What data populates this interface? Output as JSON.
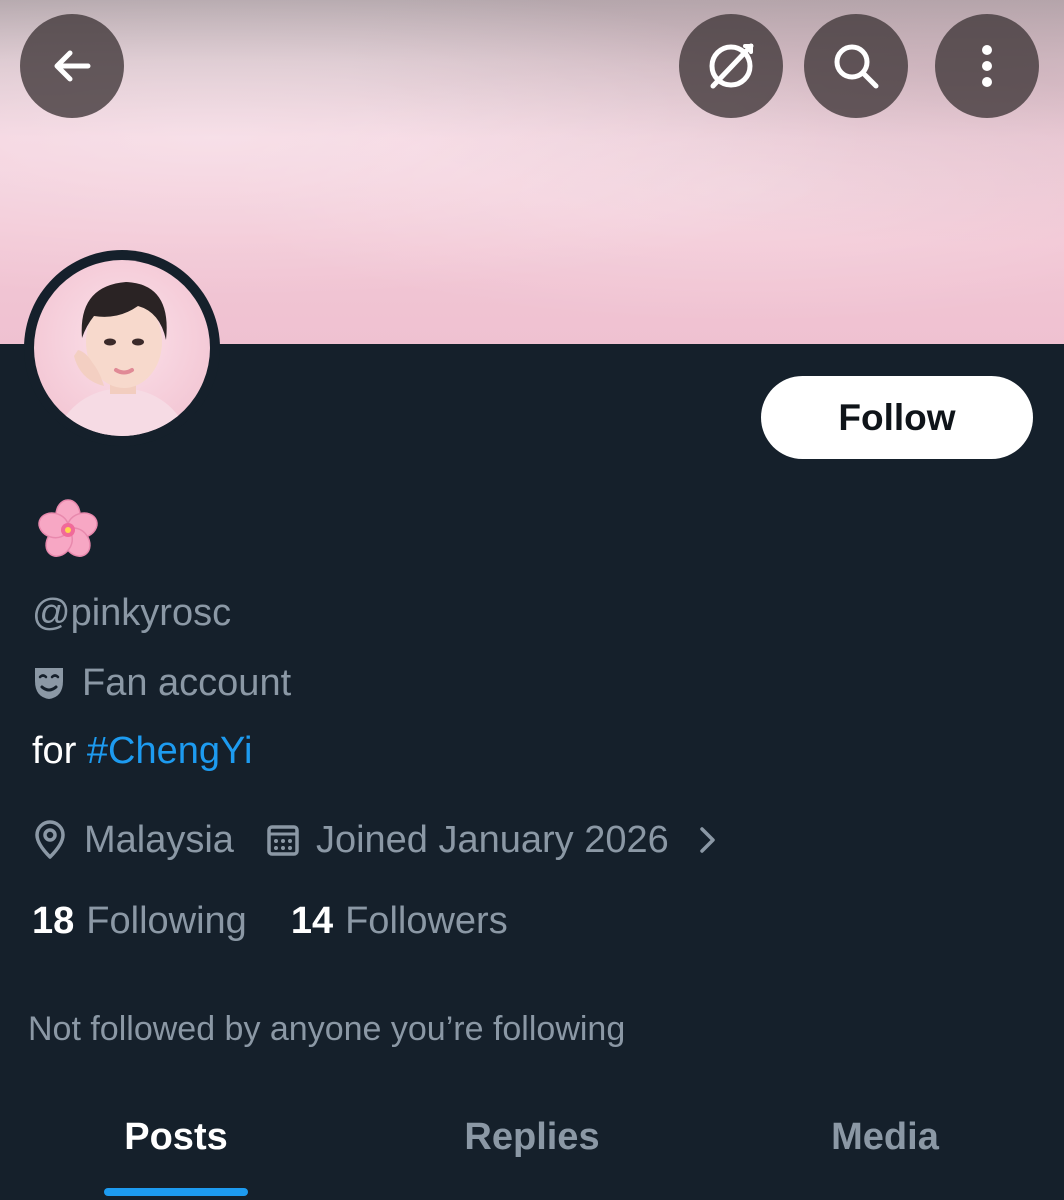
{
  "header": {
    "back_icon": "arrow-left-icon",
    "grok_icon": "grok-icon",
    "search_icon": "search-icon",
    "more_icon": "more-vertical-icon"
  },
  "profile": {
    "name_emoji": "cherry-blossom-icon",
    "handle": "@pinkyrosc",
    "category_icon": "theater-masks-icon",
    "category": "Fan account",
    "bio_prefix": "for ",
    "bio_hashtag": "#ChengYi",
    "location": "Malaysia",
    "joined": "Joined January 2026",
    "following_count": "18",
    "following_label": "Following",
    "followers_count": "14",
    "followers_label": "Followers",
    "not_followed_text": "Not followed by anyone you’re following"
  },
  "actions": {
    "follow_label": "Follow"
  },
  "tabs": [
    {
      "label": "Posts",
      "active": true
    },
    {
      "label": "Replies",
      "active": false
    },
    {
      "label": "Media",
      "active": false
    }
  ],
  "colors": {
    "background": "#15202b",
    "accent": "#1d9bf0",
    "muted_text": "#8b98a5",
    "banner_pink": "#f2c7d5"
  }
}
